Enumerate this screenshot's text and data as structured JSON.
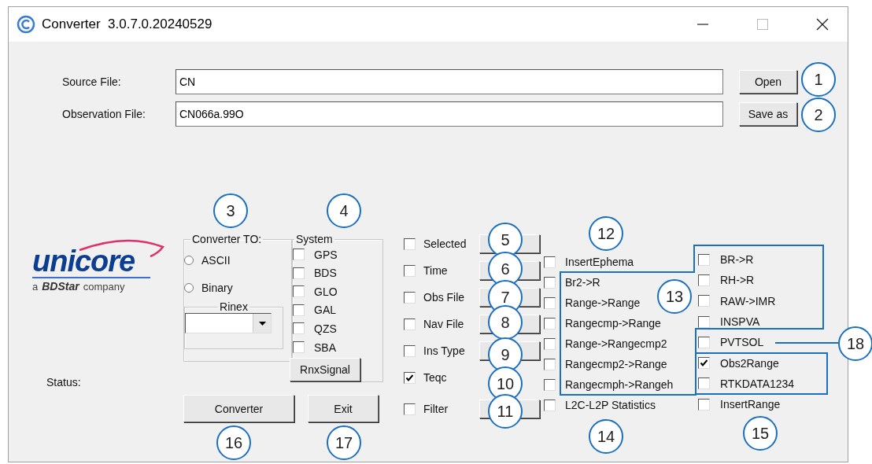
{
  "window": {
    "title": "Converter  3.0.7.0.20240529"
  },
  "source_file": {
    "label": "Source File:",
    "value": "CN",
    "button": "Open"
  },
  "observation_file": {
    "label": "Observation File:",
    "value": "CN066a.99O",
    "button": "Save as"
  },
  "logo": {
    "name": "unicore",
    "prefix": "a",
    "brand": "BDStar",
    "suffix": "company"
  },
  "status": {
    "label": "Status:"
  },
  "converter_to": {
    "title": "Converter TO:",
    "options": [
      {
        "label": "ASCII",
        "selected": false
      },
      {
        "label": "Binary",
        "selected": false
      }
    ],
    "rinex": {
      "title": "Rinex"
    }
  },
  "system": {
    "title": "System",
    "items": [
      {
        "label": "GPS",
        "checked": false
      },
      {
        "label": "BDS",
        "checked": false
      },
      {
        "label": "GLO",
        "checked": false
      },
      {
        "label": "GAL",
        "checked": false
      },
      {
        "label": "QZS",
        "checked": false
      },
      {
        "label": "SBA",
        "checked": false
      }
    ],
    "button": "RnxSignal"
  },
  "options": [
    {
      "label": "Selected",
      "checked": false,
      "kind": "with-button"
    },
    {
      "label": "Time",
      "checked": false,
      "kind": "with-button"
    },
    {
      "label": "Obs File",
      "checked": false,
      "kind": "with-button"
    },
    {
      "label": "Nav File",
      "checked": false,
      "kind": "with-button"
    },
    {
      "label": "Ins Type",
      "checked": false,
      "kind": "with-button"
    },
    {
      "label": "Teqc",
      "checked": true,
      "kind": "plain"
    },
    {
      "label": "Filter",
      "checked": false,
      "kind": "with-button"
    }
  ],
  "conversions": [
    {
      "label": "InsertEphema",
      "checked": false
    },
    {
      "label": "Br2->R",
      "checked": false
    },
    {
      "label": "Range->Range",
      "checked": false
    },
    {
      "label": "Rangecmp->Range",
      "checked": false
    },
    {
      "label": "Range->Rangecmp2",
      "checked": false
    },
    {
      "label": "Rangecmp2->Range",
      "checked": false
    },
    {
      "label": "Rangecmph->Rangeh",
      "checked": false
    },
    {
      "label": "L2C-L2P Statistics",
      "checked": false
    }
  ],
  "records": [
    {
      "label": "BR->R",
      "checked": false
    },
    {
      "label": "RH->R",
      "checked": false
    },
    {
      "label": "RAW->IMR",
      "checked": false
    },
    {
      "label": "INSPVA",
      "checked": false
    },
    {
      "label": "PVTSOL",
      "checked": false
    },
    {
      "label": "Obs2Range",
      "checked": true
    },
    {
      "label": "RTKDATA1234",
      "checked": false
    },
    {
      "label": "InsertRange",
      "checked": false
    }
  ],
  "buttons": [
    "Converter",
    "Exit"
  ],
  "callouts": [
    {
      "label": "1"
    },
    {
      "label": "2"
    },
    {
      "label": "3"
    },
    {
      "label": "4"
    },
    {
      "label": "5"
    },
    {
      "label": "6"
    },
    {
      "label": "7"
    },
    {
      "label": "8"
    },
    {
      "label": "9"
    },
    {
      "label": "10"
    },
    {
      "label": "11"
    },
    {
      "label": "12"
    },
    {
      "label": "13"
    },
    {
      "label": "14"
    },
    {
      "label": "15"
    },
    {
      "label": "16"
    },
    {
      "label": "17"
    },
    {
      "label": "18"
    }
  ]
}
